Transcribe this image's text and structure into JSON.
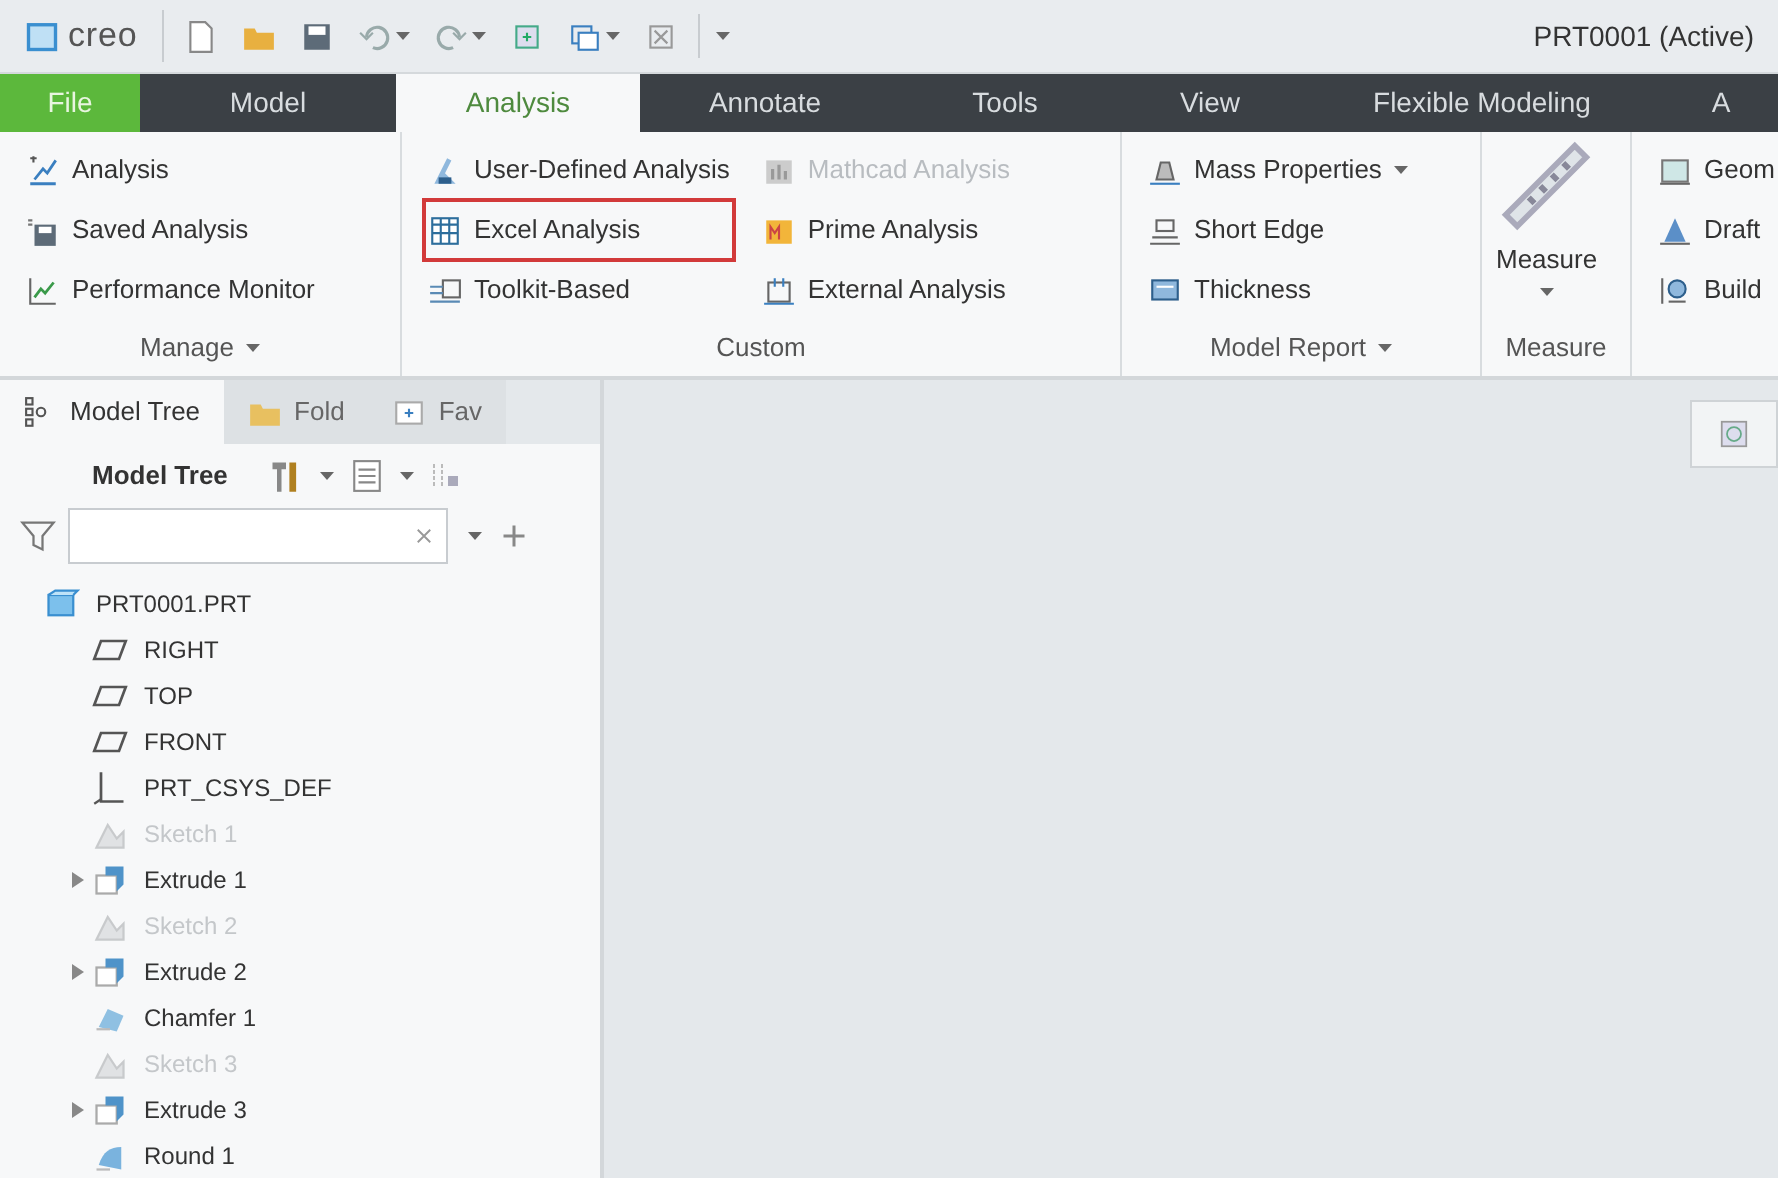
{
  "window": {
    "logo": "creo",
    "title": "PRT0001 (Active)"
  },
  "tabs": [
    {
      "label": "File",
      "kind": "file",
      "selected": false
    },
    {
      "label": "Model",
      "kind": "tab",
      "selected": false
    },
    {
      "label": "Analysis",
      "kind": "tab",
      "selected": true
    },
    {
      "label": "Annotate",
      "kind": "tab",
      "selected": false
    },
    {
      "label": "Tools",
      "kind": "tab",
      "selected": false
    },
    {
      "label": "View",
      "kind": "tab",
      "selected": false
    },
    {
      "label": "Flexible Modeling",
      "kind": "tab",
      "selected": false
    },
    {
      "label": "A",
      "kind": "tab",
      "selected": false
    }
  ],
  "ribbon": {
    "groups": [
      {
        "label": "Manage",
        "dropdown": true,
        "columns": [
          [
            {
              "label": "Analysis",
              "kind": "small",
              "disabled": false,
              "highlighted": false,
              "dropdown": false
            },
            {
              "label": "Saved Analysis",
              "kind": "small",
              "disabled": false,
              "highlighted": false,
              "dropdown": false
            },
            {
              "label": "Performance Monitor",
              "kind": "small",
              "disabled": false,
              "highlighted": false,
              "dropdown": false
            }
          ]
        ]
      },
      {
        "label": "Custom",
        "dropdown": false,
        "columns": [
          [
            {
              "label": "User-Defined Analysis",
              "kind": "small",
              "disabled": false,
              "highlighted": false,
              "dropdown": false
            },
            {
              "label": "Excel Analysis",
              "kind": "small",
              "disabled": false,
              "highlighted": true,
              "dropdown": false
            },
            {
              "label": "Toolkit-Based",
              "kind": "small",
              "disabled": false,
              "highlighted": false,
              "dropdown": false
            }
          ],
          [
            {
              "label": "Mathcad Analysis",
              "kind": "small",
              "disabled": true,
              "highlighted": false,
              "dropdown": false
            },
            {
              "label": "Prime Analysis",
              "kind": "small",
              "disabled": false,
              "highlighted": false,
              "dropdown": false
            },
            {
              "label": "External Analysis",
              "kind": "small",
              "disabled": false,
              "highlighted": false,
              "dropdown": false
            }
          ]
        ]
      },
      {
        "label": "Model Report",
        "dropdown": true,
        "columns": [
          [
            {
              "label": "Mass Properties",
              "kind": "small",
              "disabled": false,
              "highlighted": false,
              "dropdown": true
            },
            {
              "label": "Short Edge",
              "kind": "small",
              "disabled": false,
              "highlighted": false,
              "dropdown": false
            },
            {
              "label": "Thickness",
              "kind": "small",
              "disabled": false,
              "highlighted": false,
              "dropdown": false
            }
          ]
        ]
      },
      {
        "label": "Measure",
        "dropdown": false,
        "columns": [
          [
            {
              "label": "Measure",
              "kind": "large",
              "disabled": false,
              "highlighted": false,
              "dropdown": true
            }
          ]
        ]
      },
      {
        "dropdown": false,
        "columns": [
          [
            {
              "label": "Geom",
              "kind": "small",
              "disabled": false,
              "highlighted": false,
              "dropdown": false
            },
            {
              "label": "Draft",
              "kind": "small",
              "disabled": false,
              "highlighted": false,
              "dropdown": false
            },
            {
              "label": "Build",
              "kind": "small",
              "disabled": false,
              "highlighted": false,
              "dropdown": false
            }
          ]
        ]
      }
    ]
  },
  "panel": {
    "tabs": [
      {
        "label": "Model Tree",
        "selected": true
      },
      {
        "label": "Fold",
        "selected": false
      },
      {
        "label": "Fav",
        "selected": false
      }
    ],
    "toolbar_label": "Model Tree",
    "tree": [
      {
        "label": "PRT0001.PRT",
        "kind": "part",
        "dimmed": false,
        "collapsed": false,
        "children": [
          {
            "label": "RIGHT",
            "kind": "plane",
            "dimmed": false,
            "collapsed": false
          },
          {
            "label": "TOP",
            "kind": "plane",
            "dimmed": false,
            "collapsed": false
          },
          {
            "label": "FRONT",
            "kind": "plane",
            "dimmed": false,
            "collapsed": false
          },
          {
            "label": "PRT_CSYS_DEF",
            "kind": "csys",
            "dimmed": false,
            "collapsed": false
          },
          {
            "label": "Sketch 1",
            "kind": "sketch",
            "dimmed": true,
            "collapsed": false
          },
          {
            "label": "Extrude 1",
            "kind": "extrude",
            "dimmed": false,
            "collapsed": true
          },
          {
            "label": "Sketch 2",
            "kind": "sketch",
            "dimmed": true,
            "collapsed": false
          },
          {
            "label": "Extrude 2",
            "kind": "extrude",
            "dimmed": false,
            "collapsed": true
          },
          {
            "label": "Chamfer 1",
            "kind": "chamfer",
            "dimmed": false,
            "collapsed": false
          },
          {
            "label": "Sketch 3",
            "kind": "sketch",
            "dimmed": true,
            "collapsed": false
          },
          {
            "label": "Extrude 3",
            "kind": "extrude",
            "dimmed": false,
            "collapsed": true
          },
          {
            "label": "Round 1",
            "kind": "round",
            "dimmed": false,
            "collapsed": false
          }
        ]
      }
    ]
  }
}
